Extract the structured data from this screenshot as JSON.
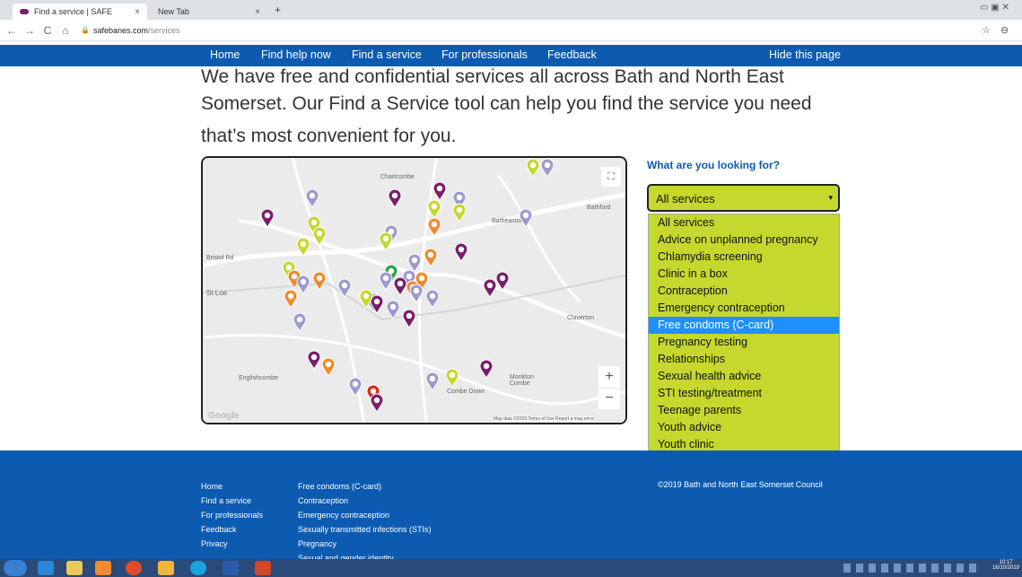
{
  "browser": {
    "tabs": [
      {
        "title": "Find a service | SAFE",
        "close": "×"
      },
      {
        "title": "New Tab",
        "close": "×"
      }
    ],
    "new_tab": "+",
    "url_host": "safebanes.com",
    "url_path": "/services",
    "back": "←",
    "forward": "→",
    "reload": "C",
    "home": "⌂"
  },
  "nav": {
    "items": [
      "Home",
      "Find help now",
      "Find a service",
      "For professionals",
      "Feedback"
    ],
    "hide": "Hide this page"
  },
  "hero": {
    "line1": "We have free and confidential services all across Bath and North East",
    "line2": "Somerset. Our Find a Service tool can help you find the service you need",
    "line3": "that’s most convenient for you."
  },
  "map": {
    "places": [
      "Charlcombe",
      "Bathford",
      "Batheaston",
      "Bristol Rd",
      "St Loe",
      "Englishcombe",
      "Combe Down",
      "Monkton Combe",
      "Claverton"
    ],
    "zoom_in": "+",
    "zoom_out": "−",
    "attribution": "Map data ©2019   Terms of Use   Report a map error",
    "logo": "Google"
  },
  "finder": {
    "label": "What are you looking for?",
    "selected": "All services",
    "options": [
      "All services",
      "Advice on unplanned pregnancy",
      "Chlamydia screening",
      "Clinic in a box",
      "Contraception",
      "Emergency contraception",
      "Free condoms (C-card)",
      "Pregnancy testing",
      "Relationships",
      "Sexual health advice",
      "STI testing/treatment",
      "Teenage parents",
      "Youth advice",
      "Youth clinic"
    ],
    "highlighted": "Free condoms (C-card)"
  },
  "footer": {
    "col1": [
      "Home",
      "Find a service",
      "For professionals",
      "Feedback",
      "Privacy"
    ],
    "col2": [
      "Free condoms (C-card)",
      "Contraception",
      "Emergency contraception",
      "Sexually transmitted infections (STIs)",
      "Pregnancy",
      "Sexual and gender identity"
    ],
    "copyright": "©2019 Bath and North East Somerset Council"
  },
  "taskbar": {
    "clock_time": "10:17",
    "clock_date": "16/10/2019"
  },
  "colors": {
    "brand_blue": "#0c5bb1",
    "select_green": "#c4d82e",
    "pin_purple": "#7a1e6b",
    "pin_lavender": "#9b9bd0",
    "pin_orange": "#f08a2c",
    "pin_lime": "#c4d82e"
  }
}
